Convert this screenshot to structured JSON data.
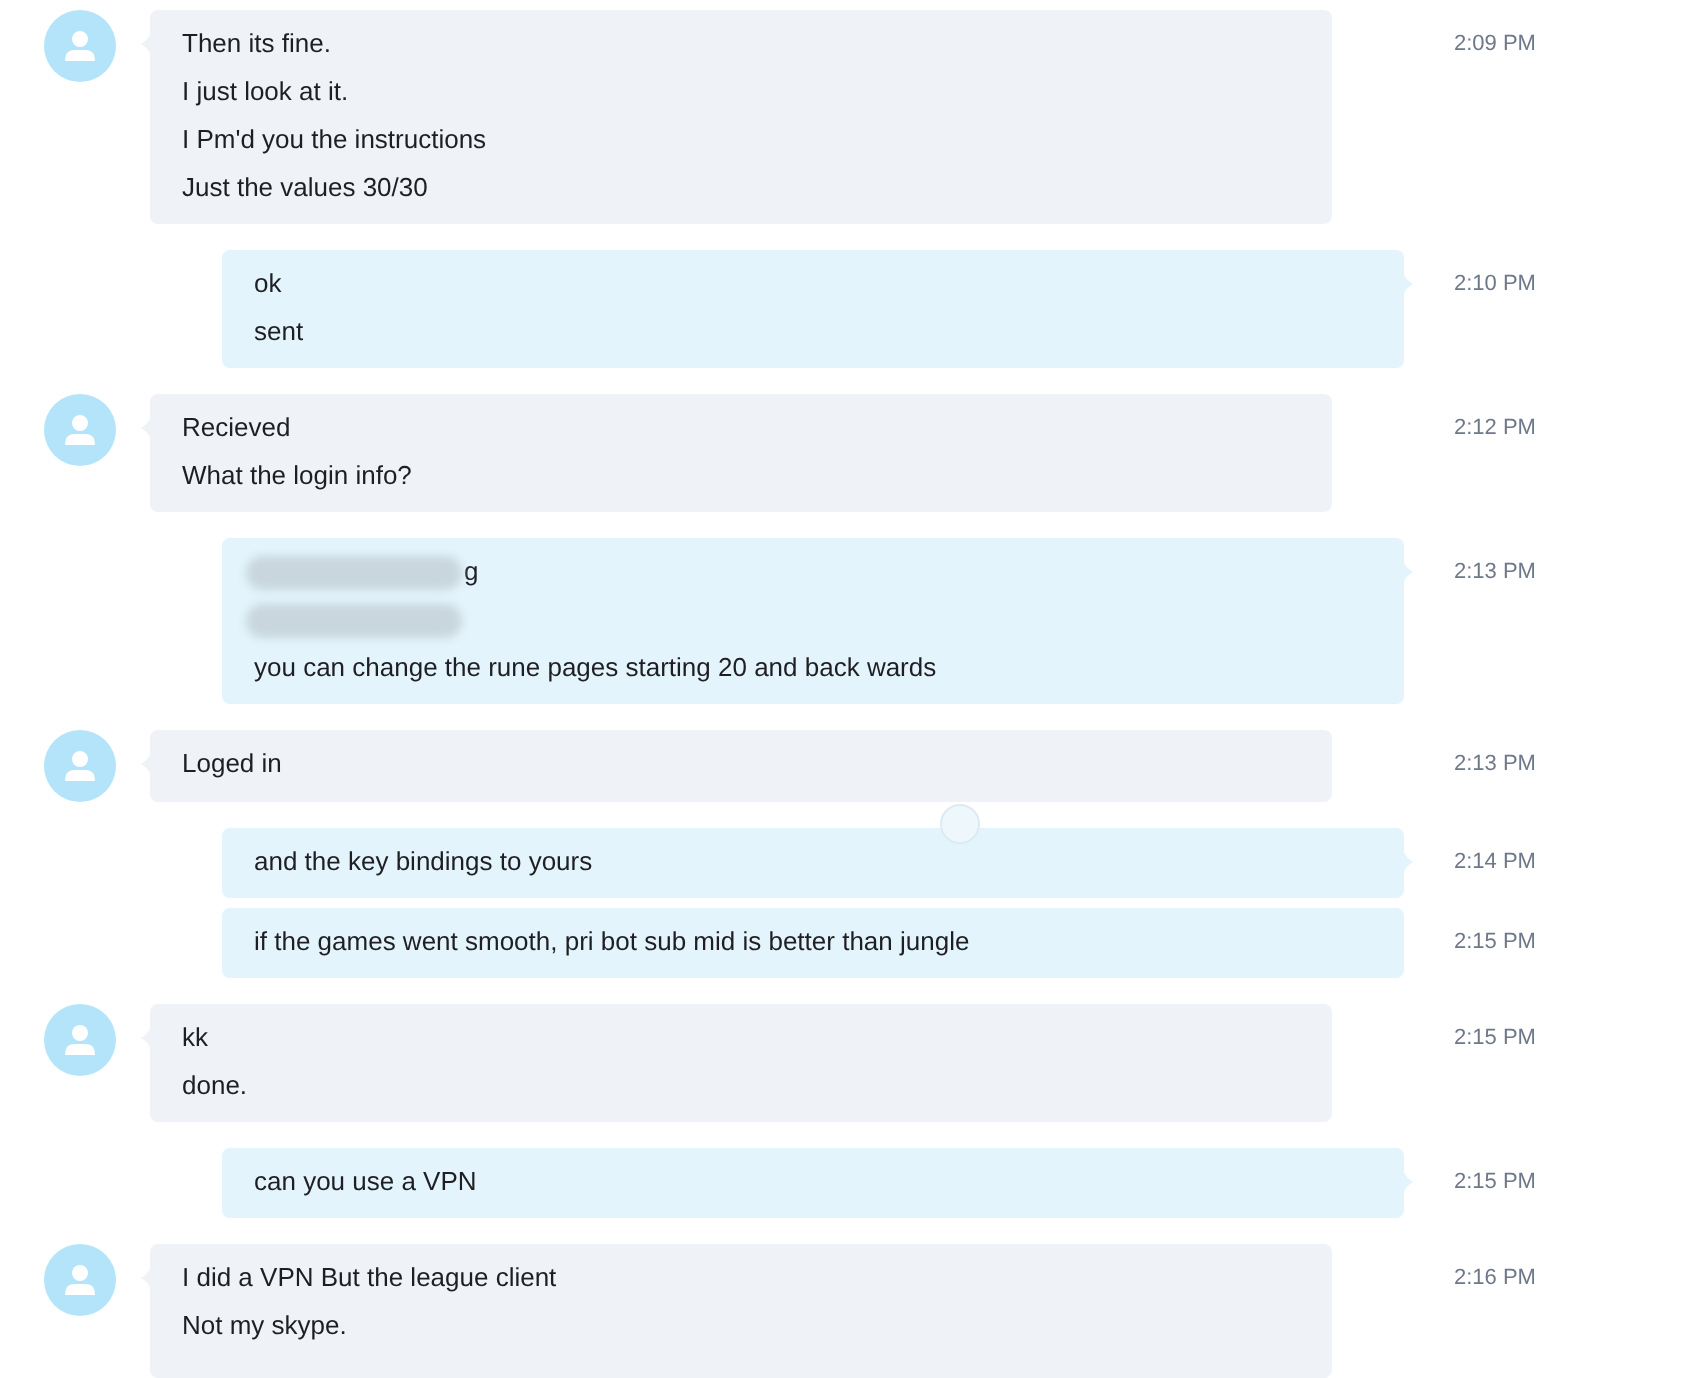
{
  "messages": [
    {
      "kind": "incoming",
      "time": "2:09 PM",
      "marker": false,
      "lines": [
        {
          "kind": "text",
          "text": "Then its fine."
        },
        {
          "kind": "text",
          "text": "I just look at it."
        },
        {
          "kind": "text",
          "text": "I Pm'd you the instructions"
        },
        {
          "kind": "text",
          "text": "Just the values 30/30"
        }
      ]
    },
    {
      "kind": "outgoing",
      "time": "2:10 PM",
      "marker": false,
      "lines": [
        {
          "kind": "text",
          "text": "ok"
        },
        {
          "kind": "text",
          "text": "sent"
        }
      ]
    },
    {
      "kind": "incoming",
      "time": "2:12 PM",
      "marker": false,
      "lines": [
        {
          "kind": "text",
          "text": "Recieved"
        },
        {
          "kind": "text",
          "text": "What the login info?"
        }
      ]
    },
    {
      "kind": "outgoing",
      "time": "2:13 PM",
      "marker": false,
      "lines": [
        {
          "kind": "redacted",
          "text": "g"
        },
        {
          "kind": "redacted"
        },
        {
          "kind": "text",
          "text": "you can change the rune pages starting 20 and back wards"
        }
      ]
    },
    {
      "kind": "incoming",
      "time": "2:13 PM",
      "marker": false,
      "lines": [
        {
          "kind": "text",
          "text": "Loged in"
        }
      ]
    },
    {
      "kind": "outgoing",
      "time": "2:14 PM",
      "marker": true,
      "lines": [
        {
          "kind": "text",
          "text": "and the key bindings to yours"
        }
      ]
    },
    {
      "kind": "outgoing",
      "time": "2:15 PM",
      "marker": false,
      "lines": [
        {
          "kind": "text",
          "text": "if the games went smooth, pri bot sub mid is better than jungle"
        }
      ]
    },
    {
      "kind": "incoming",
      "time": "2:15 PM",
      "marker": false,
      "lines": [
        {
          "kind": "text",
          "text": "kk"
        },
        {
          "kind": "text",
          "text": "done."
        }
      ]
    },
    {
      "kind": "outgoing",
      "time": "2:15 PM",
      "marker": false,
      "lines": [
        {
          "kind": "text",
          "text": "can you use a VPN"
        }
      ]
    },
    {
      "kind": "incoming",
      "time": "2:16 PM",
      "marker": false,
      "lines": [
        {
          "kind": "text",
          "text": "I did a VPN But the league client"
        },
        {
          "kind": "text",
          "text": "Not my skype."
        }
      ]
    }
  ]
}
